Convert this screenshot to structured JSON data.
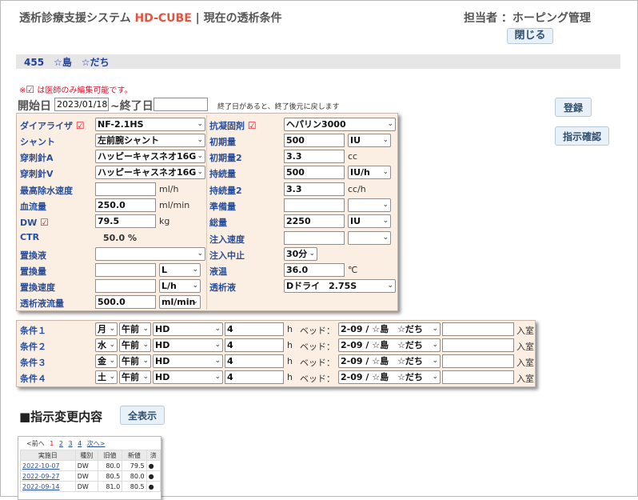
{
  "header": {
    "title_prefix": "透析診療支援システム",
    "brand": "HD-CUBE",
    "title_suffix": " | 現在の透析条件",
    "staff_label": "担当者",
    "staff_value": "：ホーピング管理",
    "close_button": "閉じる"
  },
  "patient": {
    "text": "455　☆島　☆だち"
  },
  "note": {
    "mark": "※",
    "check": "☑",
    "text": " は医師のみ編集可能です。"
  },
  "dates": {
    "start_label": "開始日",
    "start_value": "2023/01/18",
    "end_label": "~終了日",
    "end_value": "",
    "hint": "終了日があると、終了後元に戻します"
  },
  "side_buttons": {
    "register": "登録",
    "confirm": "指示確認"
  },
  "check_icon": "☑",
  "left_fields": {
    "dialyzer": {
      "label": "ダイアライザ",
      "value": "NF-2.1HS"
    },
    "shunt": {
      "label": "シャント",
      "value": "左前腕シャント"
    },
    "needle_a": {
      "label": "穿刺針A",
      "value": "ハッピーキャスネオ16G"
    },
    "needle_v": {
      "label": "穿刺針V",
      "value": "ハッピーキャスネオ16G"
    },
    "max_uf": {
      "label": "最高除水速度",
      "value": "",
      "unit": "ml/h"
    },
    "blood_flow": {
      "label": "血流量",
      "value": "250.0",
      "unit": "ml/min"
    },
    "dw": {
      "label": "DW",
      "value": "79.5",
      "unit": "kg"
    },
    "ctr": {
      "label": "CTR",
      "value": "50.0 %"
    },
    "sub_fluid": {
      "label": "置換液",
      "value": ""
    },
    "sub_volume": {
      "label": "置換量",
      "value": "",
      "unit": "L"
    },
    "sub_rate": {
      "label": "置換速度",
      "value": "",
      "unit": "L/h"
    },
    "dialysate_flow": {
      "label": "透析液流量",
      "value": "500.0",
      "unit": "ml/min"
    }
  },
  "right_fields": {
    "anticoagulant": {
      "label": "抗凝固剤",
      "value": "ヘパリン3000"
    },
    "initial": {
      "label": "初期量",
      "value": "500",
      "unit": "IU"
    },
    "initial2": {
      "label": "初期量2",
      "value": "3.3",
      "unit": "cc"
    },
    "sustained": {
      "label": "持続量",
      "value": "500",
      "unit": "IU/h"
    },
    "sustained2": {
      "label": "持続量2",
      "value": "3.3",
      "unit": "cc/h"
    },
    "prep": {
      "label": "準備量",
      "value": "",
      "unit": ""
    },
    "total": {
      "label": "総量",
      "value": "2250",
      "unit": "IU"
    },
    "inj_rate": {
      "label": "注入速度",
      "value": "",
      "unit": ""
    },
    "inj_stop": {
      "label": "注入中止",
      "value": "30分"
    },
    "temp": {
      "label": "液温",
      "value": "36.0",
      "unit": "℃"
    },
    "dialysate": {
      "label": "透析液",
      "value": "Dドライ　2.75S"
    }
  },
  "conditions": [
    {
      "label": "条件１",
      "day": "月",
      "ampm": "午前",
      "mode": "HD",
      "hours": "4",
      "h": "h",
      "bed_label": "ベッド：",
      "bed": "2-09 / ☆島　☆だち",
      "room": "入室"
    },
    {
      "label": "条件２",
      "day": "水",
      "ampm": "午前",
      "mode": "HD",
      "hours": "4",
      "h": "h",
      "bed_label": "ベッド：",
      "bed": "2-09 / ☆島　☆だち",
      "room": "入室"
    },
    {
      "label": "条件３",
      "day": "金",
      "ampm": "午前",
      "mode": "HD",
      "hours": "4",
      "h": "h",
      "bed_label": "ベッド：",
      "bed": "2-09 / ☆島　☆だち",
      "room": "入室"
    },
    {
      "label": "条件４",
      "day": "土",
      "ampm": "午前",
      "mode": "HD",
      "hours": "4",
      "h": "h",
      "bed_label": "ベッド：",
      "bed": "2-09 / ☆島　☆だち",
      "room": "入室"
    }
  ],
  "history": {
    "title": "■指示変更内容",
    "show_all": "全表示",
    "pager": {
      "prev": "<前へ",
      "pages": [
        "1",
        "2",
        "3",
        "4"
      ],
      "next": "次へ>"
    },
    "headers": [
      "実施日",
      "種別",
      "旧値",
      "新値",
      "済"
    ],
    "rows": [
      [
        "2022-10-07",
        "DW",
        "80.0",
        "79.5",
        "●"
      ],
      [
        "2022-09-27",
        "DW",
        "80.5",
        "80.0",
        "●"
      ],
      [
        "2022-09-14",
        "DW",
        "81.0",
        "80.5",
        "●"
      ]
    ]
  }
}
